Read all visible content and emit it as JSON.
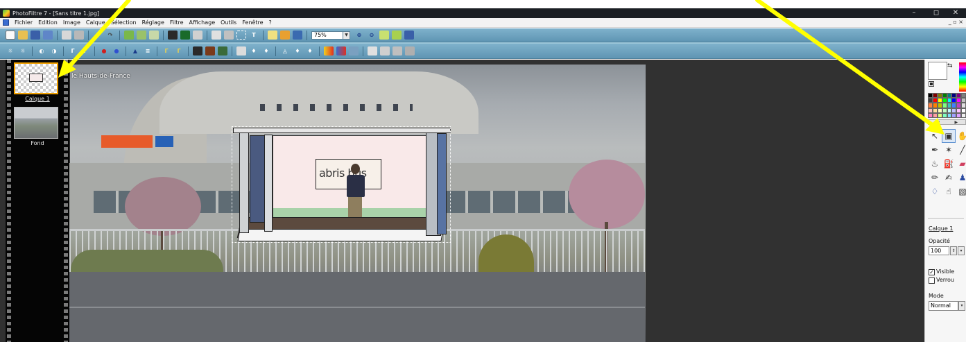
{
  "window": {
    "title": "PhotoFiltre 7 - [Sans titre 1.jpg]",
    "minimize": "–",
    "maximize": "◻",
    "close": "✕",
    "mdi_controls": "_ ▫ ×"
  },
  "menu": {
    "items": [
      "Fichier",
      "Edition",
      "Image",
      "Calque",
      "Sélection",
      "Réglage",
      "Filtre",
      "Affichage",
      "Outils",
      "Fenêtre",
      "?"
    ]
  },
  "toolbar": {
    "zoom_value": "75%"
  },
  "layers": {
    "layer1_label": "Calque 1",
    "layer2_label": "Fond"
  },
  "canvas": {
    "overlay_text": "le Hauts-de-France",
    "sign_text": "abris bus"
  },
  "panel": {
    "swap_glyph": "⇆",
    "palette_left": "◀",
    "palette_right": "▶",
    "layer_name": "Calque 1",
    "opacity_label": "Opacité",
    "opacity_value": "100",
    "spin_glyph": "⇕",
    "drop_glyph": "▾",
    "visible_label": "Visible",
    "lock_label": "Verrou",
    "check_mark": "✓",
    "mode_label": "Mode",
    "mode_value": "Normal"
  },
  "icons": {
    "toolbar1": [
      "new-icon",
      "open-icon",
      "save-icon",
      "save-as-icon",
      "print-icon",
      "scan-icon",
      "undo-icon",
      "redo-icon",
      "copy-icon",
      "paste-icon",
      "paste-new-icon",
      "frame-icon",
      "image-size-icon",
      "canvas-size-icon",
      "duplicate-icon",
      "crop-icon",
      "select-icon",
      "text-icon",
      "effects-icon",
      "filter-icon",
      "frame-window-icon",
      "zoom-in-icon",
      "zoom-out-icon",
      "fit-icon",
      "fit-window-icon",
      "full-screen-icon"
    ],
    "toolbar2": [
      "brightness-plus-icon",
      "brightness-minus-icon",
      "contrast-plus-icon",
      "contrast-minus-icon",
      "gamma-plus-icon",
      "gamma-minus-icon",
      "saturation-plus-icon",
      "saturation-minus-icon",
      "flip-icon",
      "mirror-icon",
      "auto-levels-icon",
      "auto-contrast-icon",
      "grid-a-icon",
      "grid-b-icon",
      "grid-c-icon",
      "blur-icon",
      "drop-a-icon",
      "drop-b-icon",
      "sharpen-icon",
      "drop-c-icon",
      "drop-d-icon",
      "color-balance-icon",
      "colorize-icon",
      "hue-icon",
      "rotate-icon",
      "flip-v-icon",
      "filters-icon",
      "unsharp-icon"
    ],
    "tools": [
      "select-tool-icon",
      "layer-manager-icon",
      "hand-icon",
      "eyedropper-icon",
      "magic-wand-icon",
      "line-icon",
      "fill-icon",
      "spray-icon",
      "eraser-icon",
      "brush-icon",
      "pen-icon",
      "stamp-icon",
      "blur-drop-icon",
      "smudge-icon",
      "clone-icon"
    ]
  },
  "colors": {
    "toolbar_bg": "#6fa3c0",
    "title_bg": "#1b1f24",
    "workspace_bg": "#313131",
    "annotation": "#ffff00",
    "selection_border": "#f0a000"
  }
}
